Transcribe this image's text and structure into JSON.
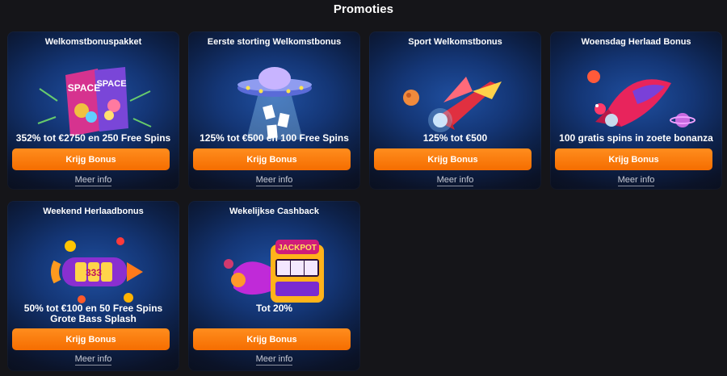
{
  "page": {
    "title": "Promoties"
  },
  "cards": [
    {
      "title": "Welkomstbonuspakket",
      "offer": "352% tot €2750 en 250 Free Spins",
      "button": "Krijg Bonus",
      "more": "Meer info",
      "art": "space-food-bags-icon"
    },
    {
      "title": "Eerste storting Welkomstbonus",
      "offer": "125% tot €500 en 100 Free Spins",
      "button": "Krijg Bonus",
      "more": "Meer info",
      "art": "ufo-icon"
    },
    {
      "title": "Sport Welkomstbonus",
      "offer": "125% tot €500",
      "button": "Krijg Bonus",
      "more": "Meer info",
      "art": "rocket-icon"
    },
    {
      "title": "Woensdag Herlaad Bonus",
      "offer": "100 gratis spins in zoete bonanza",
      "button": "Krijg Bonus",
      "more": "Meer info",
      "art": "spaceship-icon"
    },
    {
      "title": "Weekend Herlaadbonus",
      "offer_line1": "50% tot €100 en 50 Free Spins",
      "offer_line2": "Grote Bass Splash",
      "button": "Krijg Bonus",
      "more": "Meer info",
      "art": "slot-rocket-icon"
    },
    {
      "title": "Wekelijkse Cashback",
      "offer": "Tot 20%",
      "button": "Krijg Bonus",
      "more": "Meer info",
      "art": "jackpot-machine-icon"
    }
  ]
}
